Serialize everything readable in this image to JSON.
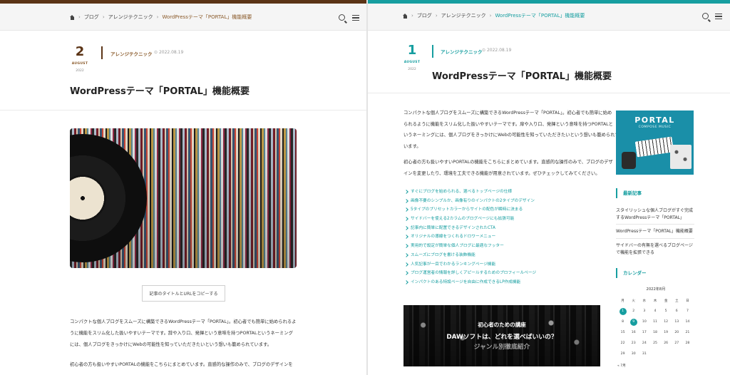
{
  "left": {
    "breadcrumb": [
      "ブログ",
      "アレンジテクニック",
      "WordPressテーマ「PORTAL」機能概要"
    ],
    "date": {
      "day": "2",
      "month": "AUGUST",
      "year": "2022"
    },
    "category": "アレンジテクニック",
    "posted": "2022.08.19",
    "title": "WordPressテーマ「PORTAL」機能概要",
    "copy_button": "記事のタイトルとURLをコピーする",
    "body": [
      "コンパクトな個人ブログをスムーズに構築できるWordPressテーマ「PORTAL」。初心者でも簡単に始められるよ",
      "うに機能をスリム化した扱いやすいテーマです。辞や入り口、発揮という意味を持つPORTALというネーミング",
      "には、個人ブログをきっかけにWebの可能性を知っていただきたいという想いも籠められています。"
    ],
    "body2": "初心者の方も扱いやすいPORTALの機能をこちらにまとめています。直感的な操作のみで、ブログのデザインを",
    "colors": {
      "accent": "#5b3416"
    }
  },
  "right": {
    "breadcrumb": [
      "ブログ",
      "アレンジテクニック",
      "WordPressテーマ「PORTAL」機能概要"
    ],
    "date": {
      "day": "1",
      "month": "AUGUST",
      "year": "2022"
    },
    "category": "アレンジテクニック",
    "posted": "2022.08.19",
    "title": "WordPressテーマ「PORTAL」機能概要",
    "body": [
      "コンパクトな個人ブログをスムーズに構築できるWordPressテーマ「PORTAL」。初心者でも簡単に始め",
      "られるように機能をスリム化した扱いやすいテーマです。扉や入り口、発揮という意味を持つPORTALと",
      "いうネーミングには、個人ブログをきっかけにWebの可能性を知っていただきたいという想いも籠められて",
      "います。"
    ],
    "body2": [
      "初心者の方も扱いやすいPORTALの機能をこちらにまとめています。直感的な操作のみで、ブログのデザ",
      "インを変更したり、環境を工夫できる機能が用意されています。ぜひチェックしてみてください。"
    ],
    "toc": [
      "すぐにブログを始められる、選べるトップページの仕様",
      "画像不要のシンプルか、画像有りのインパクトの2タイプのデザイン",
      "5タイプのプリセットカラーからサイトの配色が瞬時に決まる",
      "サイドバーを使える2カラムのブログページにも拡張可能",
      "記事内に簡単に配置できるデザインされたCTA",
      "オリジナルの導線をつくれるドロワーメニュー",
      "実用的で設定が簡単な個人ブログに最適なフッター",
      "スムーズにブログを書ける装飾機能",
      "人気記事が一目でわかるランキングページ機能",
      "ブログ運営者の情報を詳しくアピールするためのプロフィールページ",
      "インパクトのある特設ページを自由に作成できるLP作成機能"
    ],
    "promo": {
      "line1": "初心者のための講座",
      "line2": "DAWソフトは、どれを選べばいいの？",
      "line3": "ジャンル別徹底紹介"
    },
    "sidebar": {
      "ad_title": "PORTAL",
      "ad_sub": "COMPOSE MUSIC",
      "recent_head": "最新記事",
      "recent": [
        "スタイリッシュな個人ブログがすぐ完成するWordPressテーマ「PORTAL」",
        "WordPressテーマ「PORTAL」機能概要",
        "サイドバーの有無を選べるブログページで機能を拡張できる"
      ],
      "calendar_head": "カレンダー",
      "calendar_caption": "2022年8月",
      "weekdays": [
        "月",
        "火",
        "水",
        "木",
        "金",
        "土",
        "日"
      ],
      "weeks": [
        [
          "1",
          "2",
          "3",
          "4",
          "5",
          "6",
          "7"
        ],
        [
          "8",
          "9",
          "10",
          "11",
          "12",
          "13",
          "14"
        ],
        [
          "15",
          "16",
          "17",
          "18",
          "19",
          "20",
          "21"
        ],
        [
          "22",
          "23",
          "24",
          "25",
          "26",
          "27",
          "28"
        ],
        [
          "29",
          "30",
          "31",
          "",
          "",
          "",
          ""
        ]
      ],
      "highlighted_days": [
        "1",
        "9"
      ],
      "prev_link": "« 7月"
    },
    "colors": {
      "accent": "#169ea0"
    }
  }
}
